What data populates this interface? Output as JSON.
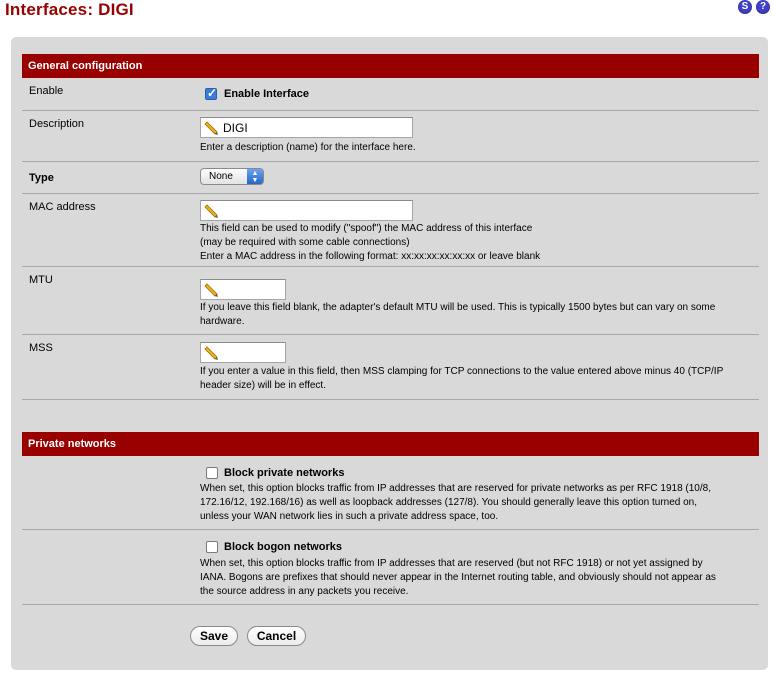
{
  "page": {
    "title": "Interfaces: DIGI"
  },
  "top_icons": {
    "status_label": "S",
    "help_label": "?"
  },
  "general": {
    "header": "General configuration",
    "enable": {
      "label": "Enable",
      "checkbox_label": "Enable Interface",
      "checked": true
    },
    "description": {
      "label": "Description",
      "value": "DIGI",
      "hint": "Enter a description (name) for the interface here."
    },
    "type": {
      "label": "Type",
      "selected": "None"
    },
    "mac": {
      "label": "MAC address",
      "value": "",
      "hint_lines": [
        "This field can be used to modify (\"spoof\") the MAC address of this interface",
        "(may be required with some cable connections)",
        "Enter a MAC address in the following format: xx:xx:xx:xx:xx:xx or leave blank"
      ]
    },
    "mtu": {
      "label": "MTU",
      "value": "",
      "hint_lines": [
        "If you leave this field blank, the adapter's default MTU will be used. This is typically 1500 bytes but can vary on some",
        "hardware."
      ]
    },
    "mss": {
      "label": "MSS",
      "value": "",
      "hint_lines": [
        "If you enter a value in this field, then MSS clamping for TCP connections to the value entered above minus 40 (TCP/IP",
        "header size) will be in effect."
      ]
    }
  },
  "private": {
    "header": "Private networks",
    "block_private": {
      "checkbox_label": "Block private networks",
      "checked": false,
      "hint_lines": [
        "When set, this option blocks traffic from IP addresses that are reserved for private networks as per RFC 1918 (10/8,",
        "172.16/12, 192.168/16) as well as loopback addresses (127/8).   You should generally leave this option turned on,",
        "unless your WAN network lies in such a private address space, too."
      ]
    },
    "block_bogon": {
      "checkbox_label": "Block bogon networks",
      "checked": false,
      "hint_lines": [
        "When set, this option blocks traffic from IP addresses that are reserved (but not RFC 1918) or not yet assigned by",
        "IANA.   Bogons are prefixes that should never appear in the Internet routing table, and obviously should not appear as",
        "the source address in any packets you receive."
      ]
    }
  },
  "buttons": {
    "save": "Save",
    "cancel": "Cancel"
  },
  "colors": {
    "header_bg": "#990000",
    "title": "#990000",
    "panel_bg": "#d9d9d9",
    "checkbox_checked": "#3b7cd8"
  },
  "icons": {
    "field_icon": "pencil-icon",
    "select_icon": "up-down-arrows-icon"
  }
}
